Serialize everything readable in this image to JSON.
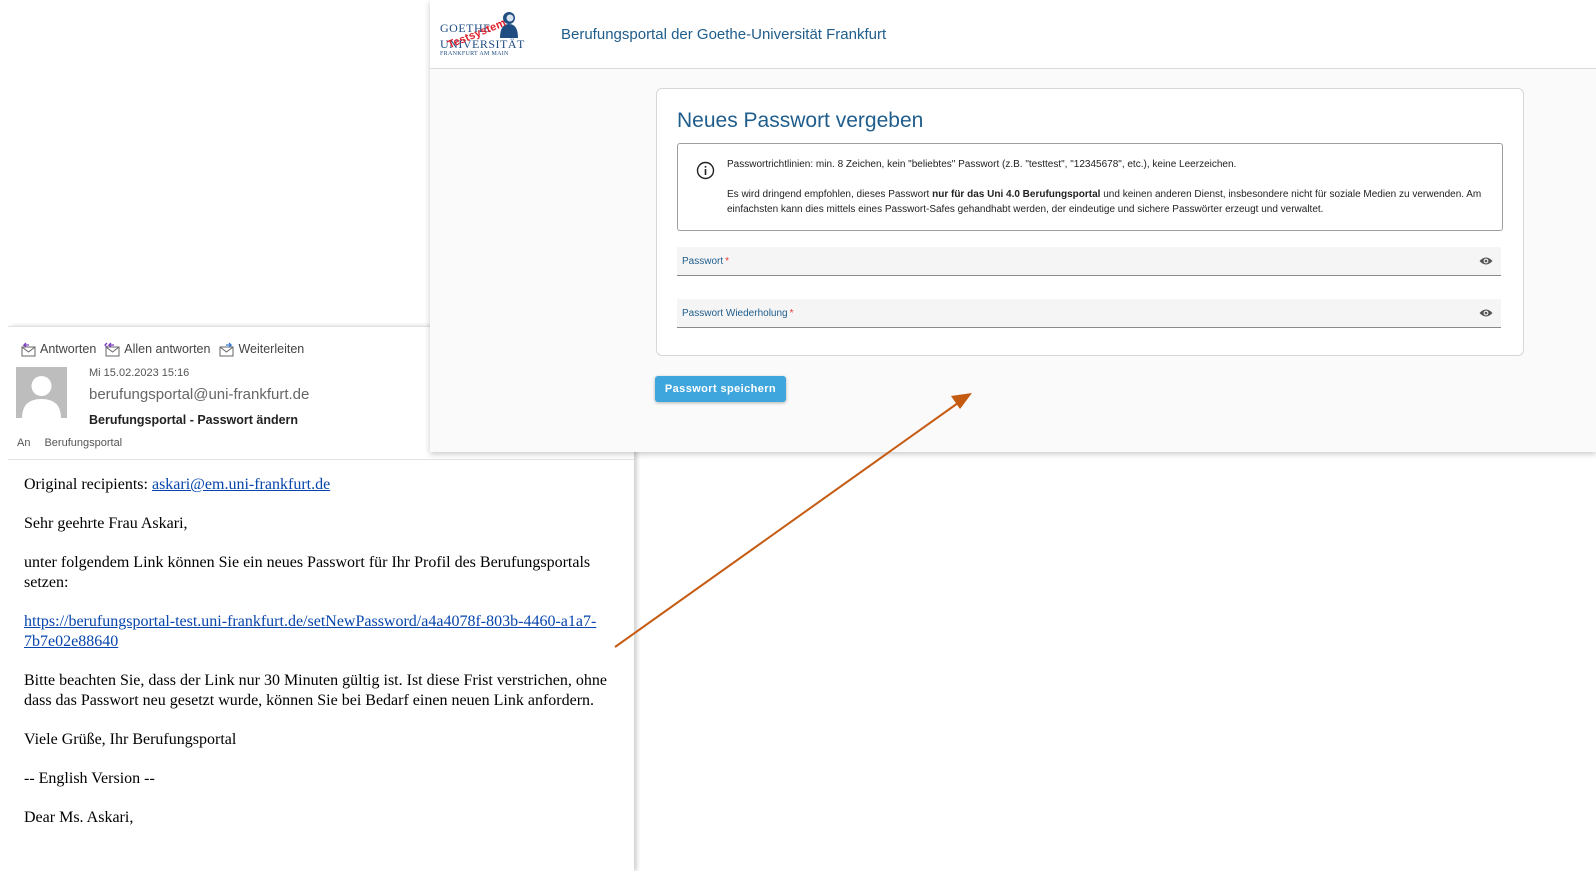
{
  "email": {
    "actions": [
      {
        "label": "Antworten",
        "icon": "reply-icon"
      },
      {
        "label": "Allen antworten",
        "icon": "reply-all-icon"
      },
      {
        "label": "Weiterleiten",
        "icon": "forward-icon"
      }
    ],
    "date": "Mi 15.02.2023 15:16",
    "from": "berufungsportal@uni-frankfurt.de",
    "subject": "Berufungsportal - Passwort ändern",
    "to_label": "An",
    "to_value": "Berufungsportal",
    "body": {
      "original_recipients_label": "Original recipients: ",
      "original_recipients_email": "askari@em.uni-frankfurt.de",
      "greeting": "Sehr geehrte Frau Askari,",
      "intro": "unter folgendem Link können Sie ein neues Passwort für Ihr Profil des Berufungsportals setzen:",
      "link": "https://berufungsportal-test.uni-frankfurt.de/setNewPassword/a4a4078f-803b-4460-a1a7-7b7e02e88640",
      "notice": "Bitte beachten Sie, dass der Link nur 30 Minuten gültig ist. Ist diese Frist verstrichen, ohne dass das Passwort neu gesetzt wurde, können Sie bei Bedarf einen neuen Link anfordern.",
      "closing": "Viele Grüße, Ihr Berufungsportal",
      "english_header": "-- English Version --",
      "english_greeting": "Dear Ms. Askari,"
    }
  },
  "portal": {
    "logo": {
      "line1": "GOETHE",
      "line2": "UNIVERSITÄT",
      "line3": "FRANKFURT AM MAIN",
      "stamp": "Testsystem"
    },
    "title": "Berufungsportal der Goethe-Universität Frankfurt",
    "card_title": "Neues Passwort vergeben",
    "info": {
      "line1": "Passwortrichtlinien: min. 8 Zeichen, kein \"beliebtes\" Passwort (z.B. \"testtest\", \"12345678\", etc.), keine Leerzeichen.",
      "line2_before": "Es wird dringend empfohlen, dieses Passwort ",
      "line2_bold": "nur für das Uni 4.0 Berufungsportal",
      "line2_after": " und keinen anderen Dienst, insbesondere nicht für soziale Medien zu verwenden. Am einfachsten kann dies mittels eines Passwort-Safes gehandhabt werden, der eindeutige und sichere Passwörter erzeugt und verwaltet."
    },
    "fields": {
      "password_label": "Passwort",
      "password_repeat_label": "Passwort Wiederholung",
      "required_marker": "*"
    },
    "save_label": "Passwort speichern"
  },
  "colors": {
    "accent": "#1f5d8c",
    "button": "#3ea6dd",
    "arrow": "#c55a11",
    "required": "#e53935"
  }
}
